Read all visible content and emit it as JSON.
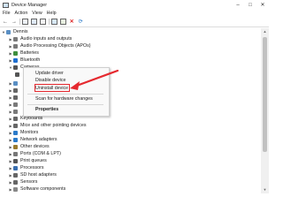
{
  "window": {
    "title": "Device Manager",
    "minimize_icon": "minimize-icon",
    "maximize_icon": "maximize-icon",
    "close_icon": "close-icon"
  },
  "menu": [
    "File",
    "Action",
    "View",
    "Help"
  ],
  "toolbar": {
    "icons": [
      "back-arrow-icon",
      "forward-arrow-icon",
      "properties-icon",
      "help-icon",
      "scan-icon",
      "monitor-icon",
      "add-driver-icon",
      "remove-icon",
      "update-icon"
    ]
  },
  "tree": {
    "root": "Dennis",
    "items": [
      {
        "label": "Audio inputs and outputs",
        "color": "#7a7a7a"
      },
      {
        "label": "Batteries",
        "color": "#3f8f3f"
      },
      {
        "label": "Bluetooth",
        "color": "#1f6fd1"
      },
      {
        "label": "Cameras",
        "color": "#555555"
      },
      {
        "label": "Keyboards",
        "color": "#666666"
      },
      {
        "label": "Mice and other pointing devices",
        "color": "#666666"
      },
      {
        "label": "Monitors",
        "color": "#2a7ac9"
      },
      {
        "label": "Network adapters",
        "color": "#2a7ac9"
      },
      {
        "label": "Other devices",
        "color": "#9a7b2f"
      },
      {
        "label": "Ports (COM & LPT)",
        "color": "#777777"
      },
      {
        "label": "Print queues",
        "color": "#555555"
      },
      {
        "label": "Processors",
        "color": "#3a6fb0"
      },
      {
        "label": "SD host adapters",
        "color": "#666666"
      },
      {
        "label": "Sensors",
        "color": "#666666"
      },
      {
        "label": "Software components",
        "color": "#888888"
      }
    ],
    "sub_audio": "Audio Processing Objects (APOs)"
  },
  "context_menu": {
    "items": [
      "Update driver",
      "Disable device",
      "Uninstall device",
      "Scan for hardware changes",
      "Properties"
    ],
    "highlight_color": "#e5292f"
  },
  "annotation": {
    "arrow_color": "#e5292f"
  }
}
